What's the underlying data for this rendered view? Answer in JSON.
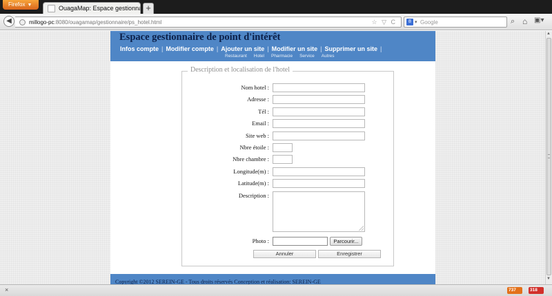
{
  "browser": {
    "app_button": "Firefox",
    "tab_title": "OuagaMap: Espace gestionnaire",
    "new_tab": "+",
    "url_host": "millogo-pc",
    "url_rest": ":8080/ouagamap/gestionnaire/ps_hotel.html",
    "urlbar_icons": "☆ ▽ C",
    "search_engine": "8",
    "search_placeholder": "Google",
    "status_close": "×",
    "addon_a": "737",
    "addon_b": "318"
  },
  "header": {
    "title": "Espace gestionnaire de point d'intérêt",
    "menu": [
      {
        "label": "Infos compte"
      },
      {
        "label": "Modifier compte"
      },
      {
        "label": "Ajouter un site"
      },
      {
        "label": "Modifier un site"
      },
      {
        "label": "Supprimer un site"
      }
    ],
    "menu_separator": "|",
    "submenu": [
      {
        "label": "Restaurant"
      },
      {
        "label": "Hotel"
      },
      {
        "label": "Pharmacie"
      },
      {
        "label": "Service"
      },
      {
        "label": "Autres"
      }
    ]
  },
  "form": {
    "legend": "Description et localisation de l'hotel",
    "fields": {
      "nom": {
        "label": "Nom hotel :",
        "value": ""
      },
      "adresse": {
        "label": "Adresse :",
        "value": ""
      },
      "tel": {
        "label": "Tél :",
        "value": ""
      },
      "email": {
        "label": "Email :",
        "value": ""
      },
      "site": {
        "label": "Site web :",
        "value": ""
      },
      "etoiles": {
        "label": "Nbre étoile :",
        "value": ""
      },
      "chambres": {
        "label": "Nbre chambre :",
        "value": ""
      },
      "longitude": {
        "label": "Longitude(m) :",
        "value": ""
      },
      "latitude": {
        "label": "Latitude(m) :",
        "value": ""
      },
      "description": {
        "label": "Description :",
        "value": ""
      },
      "photo": {
        "label": "Photo :",
        "browse": "Parcourir..."
      }
    },
    "cancel_label": "Annuler",
    "save_label": "Enregistrer"
  },
  "footer": {
    "text": "Copyright ©2012 SEREIN-GE - Tous droits réservés Conception et réalisation: SEREIN-GE"
  }
}
